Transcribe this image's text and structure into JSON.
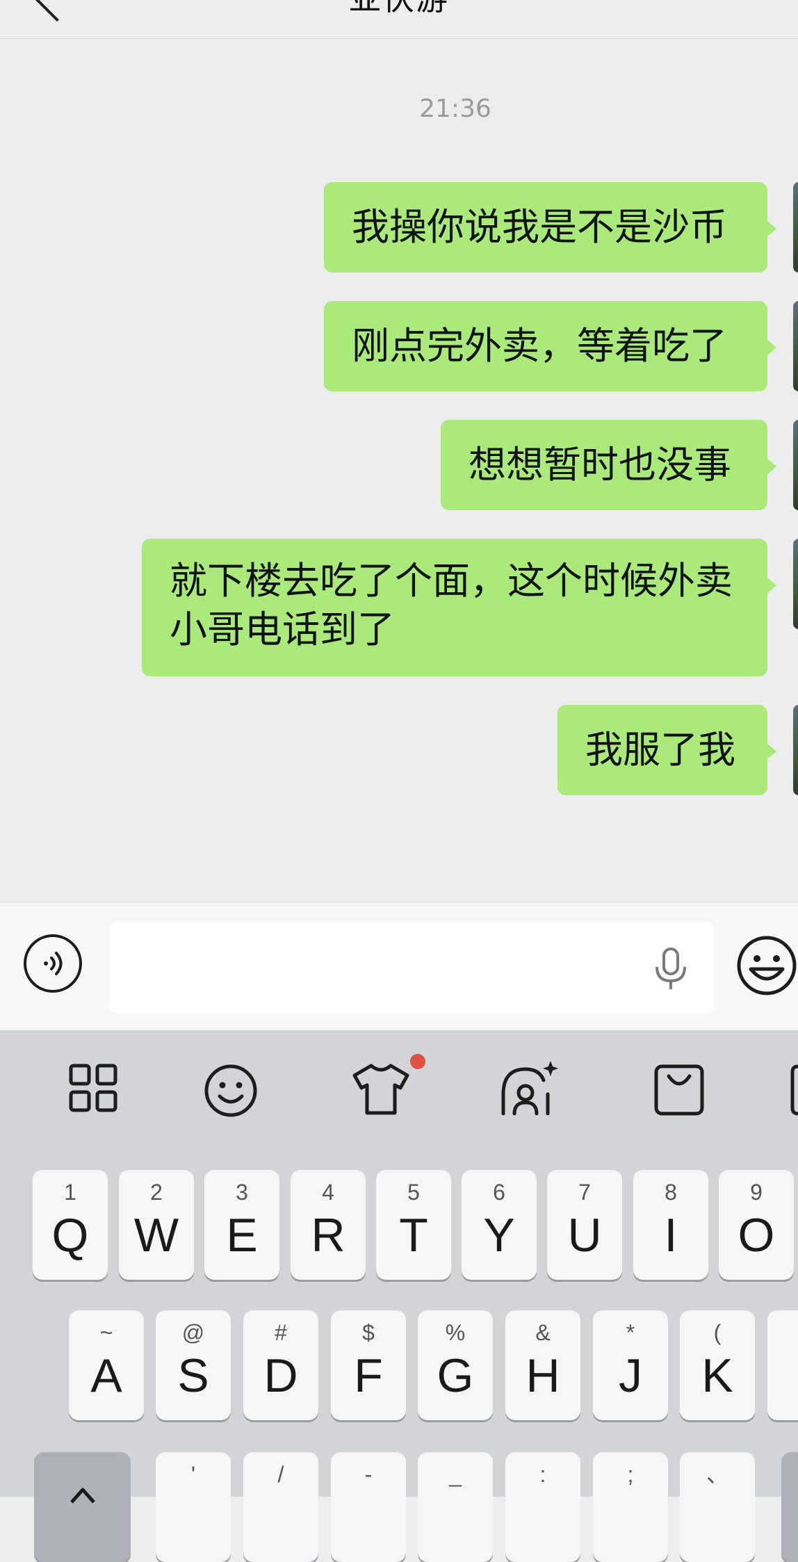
{
  "header": {
    "title_fragment": "亚伏游"
  },
  "chat": {
    "timestamp": "21:36",
    "messages": [
      {
        "text": "我操你说我是不是沙币"
      },
      {
        "text": "刚点完外卖，等着吃了"
      },
      {
        "text": "想想暂时也没事"
      },
      {
        "text": "就下楼去吃了个面，这个时候外卖小哥电话到了"
      },
      {
        "text": "我服了我"
      }
    ]
  },
  "input": {
    "value": "",
    "placeholder": ""
  },
  "keyboard": {
    "row1": [
      {
        "hint": "1",
        "key": "Q"
      },
      {
        "hint": "2",
        "key": "W"
      },
      {
        "hint": "3",
        "key": "E"
      },
      {
        "hint": "4",
        "key": "R"
      },
      {
        "hint": "5",
        "key": "T"
      },
      {
        "hint": "6",
        "key": "Y"
      },
      {
        "hint": "7",
        "key": "U"
      },
      {
        "hint": "8",
        "key": "I"
      },
      {
        "hint": "9",
        "key": "O"
      }
    ],
    "row2": [
      {
        "hint": "~",
        "key": "A"
      },
      {
        "hint": "@",
        "key": "S"
      },
      {
        "hint": "#",
        "key": "D"
      },
      {
        "hint": "$",
        "key": "F"
      },
      {
        "hint": "%",
        "key": "G"
      },
      {
        "hint": "&",
        "key": "H"
      },
      {
        "hint": "*",
        "key": "J"
      },
      {
        "hint": "(",
        "key": "K"
      }
    ],
    "row3_hints": [
      "'",
      "/",
      "-",
      "_",
      ":",
      ";",
      "、"
    ]
  },
  "colors": {
    "bubble": "#a9ea7a",
    "background": "#ededed",
    "keyboard": "#d3d4d8",
    "notification_dot": "#e05345"
  }
}
